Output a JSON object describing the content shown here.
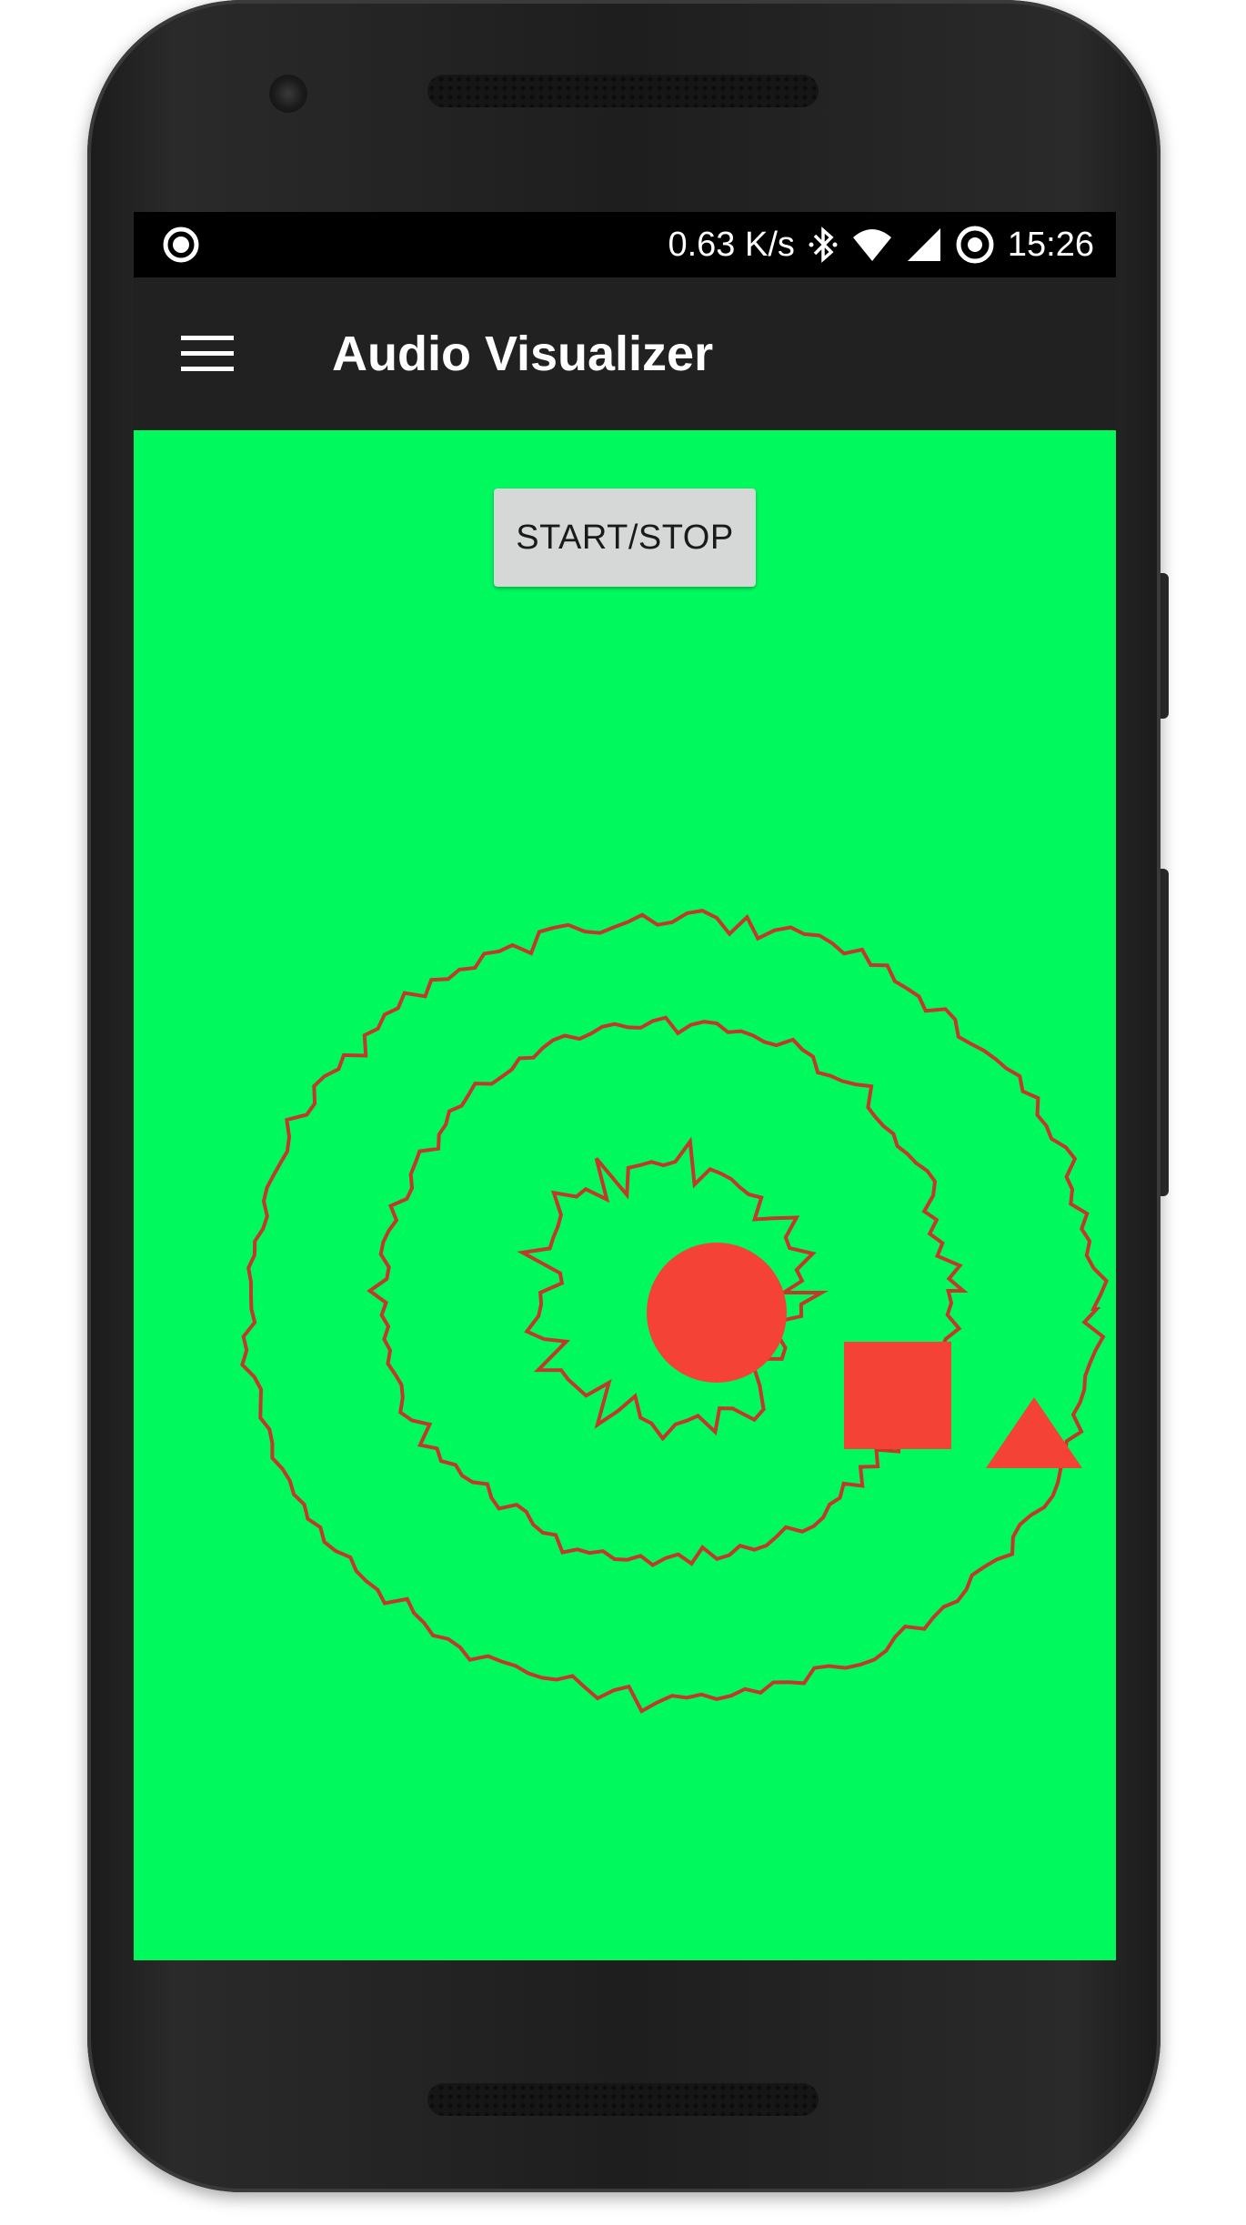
{
  "status_bar": {
    "net_speed": "0.63 K/s",
    "time": "15:26",
    "icons": [
      "record-indicator-icon",
      "bluetooth-icon",
      "wifi-icon",
      "cell-signal-icon",
      "sync-icon"
    ]
  },
  "app_bar": {
    "title": "Audio Visualizer",
    "menu_icon": "hamburger-menu-icon"
  },
  "main": {
    "button_label": "START/STOP"
  },
  "colors": {
    "background": "#00fa5e",
    "shape_fill": "#f44336",
    "ring_stroke": "#c0392b",
    "app_bar": "#212121",
    "status_bar": "#000000"
  },
  "visualizer": {
    "rings": [
      "outer-ring",
      "middle-ring",
      "inner-ring"
    ],
    "shapes": [
      "circle",
      "square",
      "triangle"
    ]
  }
}
